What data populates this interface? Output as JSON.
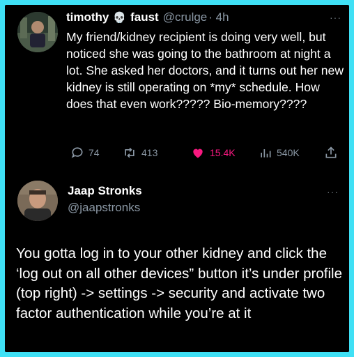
{
  "tweet1": {
    "display_name": "timothy",
    "name_emoji": "skull-icon",
    "display_name_suffix": "faust",
    "handle": "@crulge",
    "time": "· 4h",
    "text": "My friend/kidney recipient is doing very well, but noticed she was going to the bathroom at night a lot. She asked her doctors, and it turns out her new kidney is still operating on *my* schedule. How does that even work????? Bio-memory????",
    "replies": "74",
    "retweets": "413",
    "likes": "15.4K",
    "views": "540K",
    "more": "···"
  },
  "tweet2": {
    "display_name": "Jaap Stronks",
    "handle": "@jaapstronks",
    "more": "···",
    "text": "You gotta log in to your other kidney and click the ‘log out on all other devices” button it’s under profile (top right) -> settings -> security and activate two factor authentication while you’re at it"
  },
  "colors": {
    "background_border": "#3fe0f5",
    "card": "#000000",
    "text_primary": "#ffffff",
    "text_secondary": "#8b98a5",
    "like": "#f91880"
  }
}
